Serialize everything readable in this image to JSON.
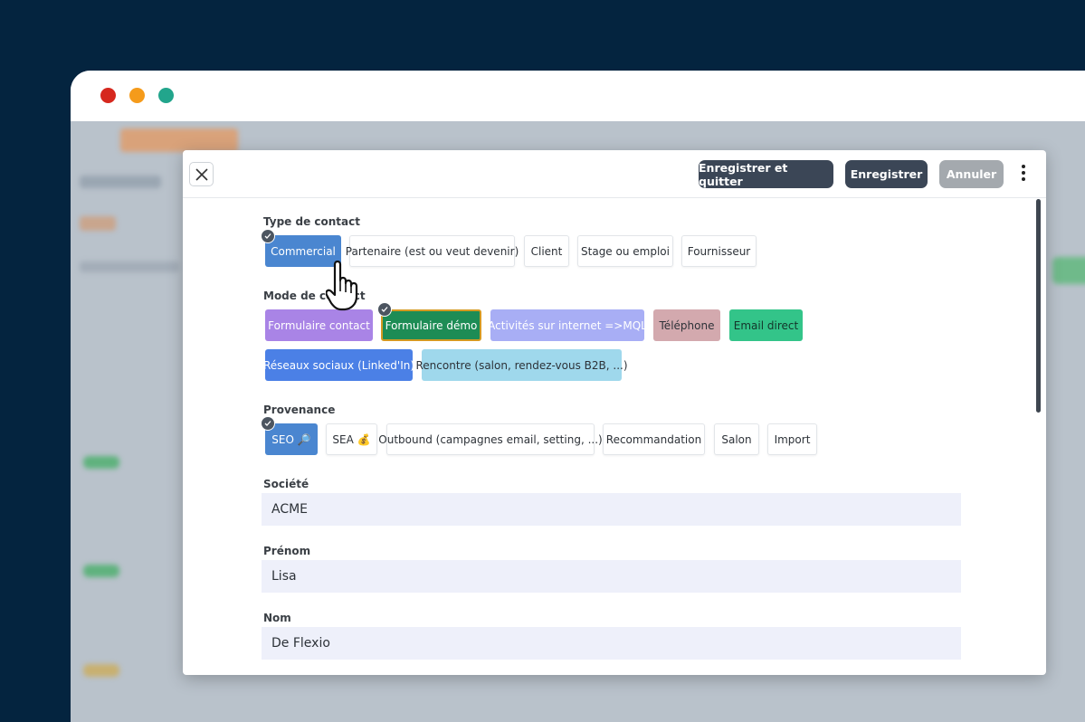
{
  "window": {
    "controls": [
      "close",
      "minimize",
      "maximize"
    ]
  },
  "toolbar": {
    "save_quit_label": "Enregistrer et quitter",
    "save_label": "Enregistrer",
    "cancel_label": "Annuler"
  },
  "contact_type": {
    "label": "Type de contact",
    "options": [
      "Commercial",
      "Partenaire (est ou veut devenir)",
      "Client",
      "Stage ou emploi",
      "Fournisseur"
    ],
    "selected": "Commercial"
  },
  "contact_mode": {
    "label": "Mode de contact",
    "options": [
      "Formulaire contact",
      "Formulaire démo",
      "Activités sur internet =>MQL",
      "Téléphone",
      "Email direct",
      "Réseaux sociaux (Linked'In)",
      "Rencontre (salon, rendez-vous B2B, ...)"
    ],
    "selected": "Formulaire démo"
  },
  "provenance": {
    "label": "Provenance",
    "options": [
      "SEO 🔎",
      "SEA 💰",
      "Outbound (campagnes email, setting, ...)",
      "Recommandation",
      "Salon",
      "Import"
    ],
    "selected": "SEO 🔎"
  },
  "fields": {
    "company": {
      "label": "Société",
      "value": "ACME"
    },
    "first_name": {
      "label": "Prénom",
      "value": "Lisa"
    },
    "last_name": {
      "label": "Nom",
      "value": "De Flexio"
    }
  },
  "colors": {
    "background": "#04243f",
    "primary_dark": "#3b4656",
    "selected_blue": "#4a86d0",
    "mode_purple": "#a984e6",
    "mode_green_dark": "#1d8c55",
    "mode_lavender": "#a8aef5",
    "mode_rose": "#d3a9ae",
    "mode_green": "#33c489",
    "mode_blue": "#4b80e6",
    "mode_cyan": "#9fd8ec"
  }
}
